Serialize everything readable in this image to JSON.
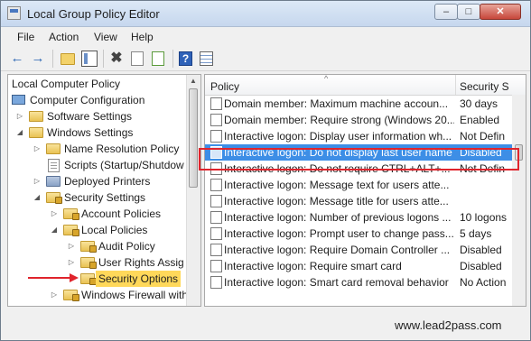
{
  "window": {
    "title": "Local Group Policy Editor"
  },
  "menu": [
    "File",
    "Action",
    "View",
    "Help"
  ],
  "tree": {
    "items": [
      {
        "label": "Local Computer Policy"
      },
      {
        "label": "Computer Configuration"
      },
      {
        "label": "Software Settings"
      },
      {
        "label": "Windows Settings"
      },
      {
        "label": "Name Resolution Policy"
      },
      {
        "label": "Scripts (Startup/Shutdow"
      },
      {
        "label": "Deployed Printers"
      },
      {
        "label": "Security Settings"
      },
      {
        "label": "Account Policies"
      },
      {
        "label": "Local Policies"
      },
      {
        "label": "Audit Policy"
      },
      {
        "label": "User Rights Assig"
      },
      {
        "label": "Security Options"
      },
      {
        "label": "Windows Firewall with"
      }
    ]
  },
  "list": {
    "columns": {
      "policy": "Policy",
      "security": "Security S"
    },
    "rows": [
      {
        "policy": "Domain member: Maximum machine accoun...",
        "setting": "30 days"
      },
      {
        "policy": "Domain member: Require strong (Windows 20...",
        "setting": "Enabled"
      },
      {
        "policy": "Interactive logon: Display user information wh...",
        "setting": "Not Defin"
      },
      {
        "policy": "Interactive logon: Do not display last user name",
        "setting": "Disabled"
      },
      {
        "policy": "Interactive logon: Do not require CTRL+ALT+...",
        "setting": "Not Defin"
      },
      {
        "policy": "Interactive logon: Message text for users atte...",
        "setting": ""
      },
      {
        "policy": "Interactive logon: Message title for users atte...",
        "setting": ""
      },
      {
        "policy": "Interactive logon: Number of previous logons ...",
        "setting": "10 logons"
      },
      {
        "policy": "Interactive logon: Prompt user to change pass...",
        "setting": "5 days"
      },
      {
        "policy": "Interactive logon: Require Domain Controller ...",
        "setting": "Disabled"
      },
      {
        "policy": "Interactive logon: Require smart card",
        "setting": "Disabled"
      },
      {
        "policy": "Interactive logon: Smart card removal behavior",
        "setting": "No Action"
      }
    ]
  },
  "watermark": "www.lead2pass.com",
  "colors": {
    "selection": "#3d8ee6",
    "highlight_box": "#e0242c",
    "selected_tree": "#ffd85a"
  },
  "icons": [
    "back-arrow-icon",
    "forward-arrow-icon",
    "up-folder-icon",
    "show-hide-tree-icon",
    "delete-icon",
    "properties-icon",
    "export-icon",
    "help-icon",
    "filter-grid-icon"
  ]
}
